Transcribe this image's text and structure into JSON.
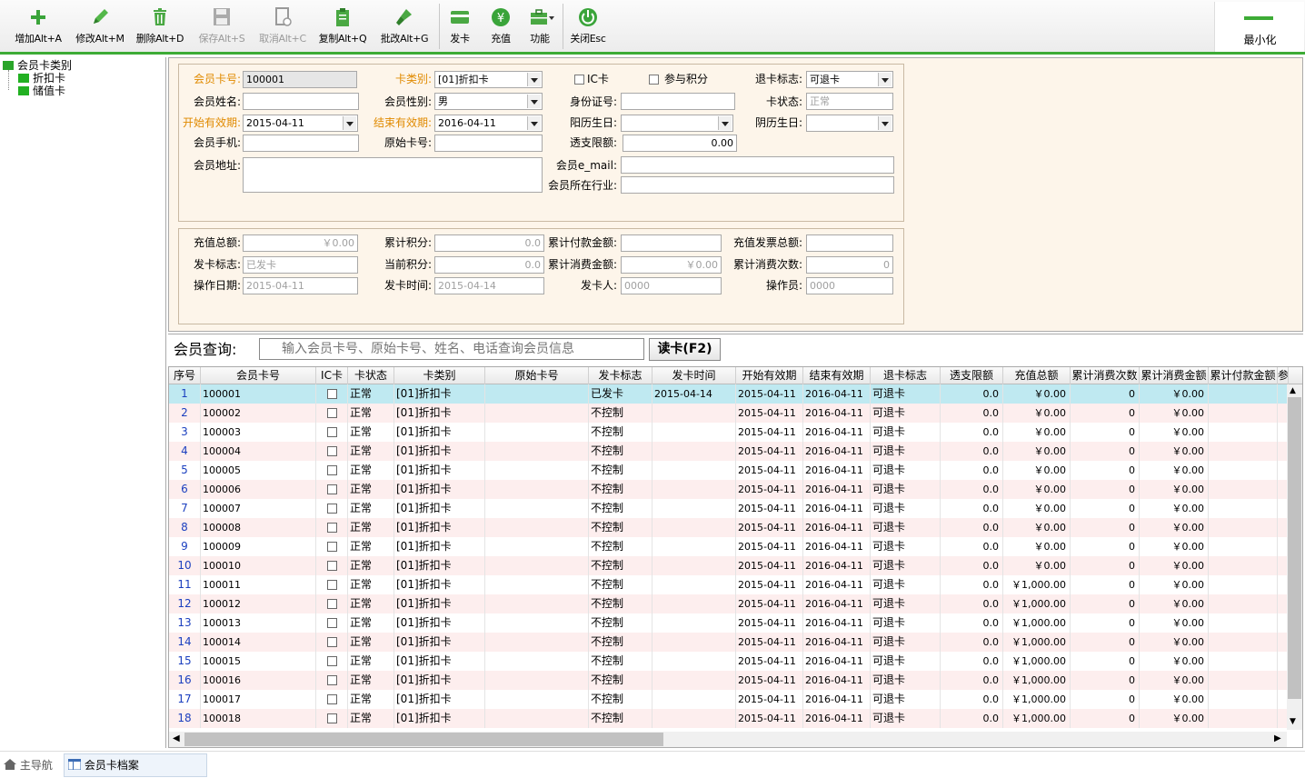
{
  "toolbar": {
    "add": "增加Alt+A",
    "edit": "修改Alt+M",
    "delete": "删除Alt+D",
    "save": "保存Alt+S",
    "cancel": "取消Alt+C",
    "copy": "复制Alt+Q",
    "batch": "批改Alt+G",
    "issue": "发卡",
    "recharge": "充值",
    "function": "功能",
    "close": "关闭Esc",
    "minimize": "最小化"
  },
  "tree": {
    "root": "会员卡类别",
    "items": [
      "折扣卡",
      "储值卡"
    ]
  },
  "form": {
    "card_no_label": "会员卡号:",
    "card_no": "100001",
    "card_type_label": "卡类别:",
    "card_type": "[01]折扣卡",
    "ic_label": "IC卡",
    "points_label": "参与积分",
    "refund_flag_label": "退卡标志:",
    "refund_flag": "可退卡",
    "name_label": "会员姓名:",
    "name": "",
    "gender_label": "会员性别:",
    "gender": "男",
    "id_label": "身份证号:",
    "id_no": "",
    "card_status_label": "卡状态:",
    "card_status": "正常",
    "start_label": "开始有效期:",
    "start": "2015-04-11",
    "end_label": "结束有效期:",
    "end": "2016-04-11",
    "solar_bday_label": "阳历生日:",
    "solar_bday": "",
    "lunar_bday_label": "阴历生日:",
    "lunar_bday": "",
    "phone_label": "会员手机:",
    "phone": "",
    "orig_card_label": "原始卡号:",
    "orig_card": "",
    "overdraft_label": "透支限额:",
    "overdraft": "0.00",
    "address_label": "会员地址:",
    "address": "",
    "email_label": "会员e_mail:",
    "email": "",
    "industry_label": "会员所在行业:",
    "industry": ""
  },
  "stats": {
    "recharge_total_label": "充值总额:",
    "recharge_total": "￥0.00",
    "cum_points_label": "累计积分:",
    "cum_points": "0.0",
    "cum_pay_label": "累计付款金额:",
    "cum_pay": "",
    "invoice_label": "充值发票总额:",
    "invoice": "",
    "issue_flag_label": "发卡标志:",
    "issue_flag": "已发卡",
    "cur_points_label": "当前积分:",
    "cur_points": "0.0",
    "cum_spend_label": "累计消费金额:",
    "cum_spend": "￥0.00",
    "spend_count_label": "累计消费次数:",
    "spend_count": "0",
    "op_date_label": "操作日期:",
    "op_date": "2015-04-11",
    "issue_time_label": "发卡时间:",
    "issue_time": "2015-04-14",
    "issuer_label": "发卡人:",
    "issuer": "0000",
    "operator_label": "操作员:",
    "operator": "0000"
  },
  "search": {
    "label": "会员查询:",
    "placeholder": "输入会员卡号、原始卡号、姓名、电话查询会员信息",
    "read_button": "读卡(F2)"
  },
  "grid": {
    "columns": [
      "序号",
      "会员卡号",
      "IC卡",
      "卡状态",
      "卡类别",
      "原始卡号",
      "发卡标志",
      "发卡时间",
      "开始有效期",
      "结束有效期",
      "退卡标志",
      "透支限额",
      "充值总额",
      "累计消费次数",
      "累计消费金额",
      "累计付款金额",
      "参"
    ],
    "rows": [
      [
        "1",
        "100001",
        "正常",
        "[01]折扣卡",
        "",
        "已发卡",
        "2015-04-14",
        "2015-04-11",
        "2016-04-11",
        "可退卡",
        "0.0",
        "￥0.00",
        "0",
        "￥0.00"
      ],
      [
        "2",
        "100002",
        "正常",
        "[01]折扣卡",
        "",
        "不控制",
        "",
        "2015-04-11",
        "2016-04-11",
        "可退卡",
        "0.0",
        "￥0.00",
        "0",
        "￥0.00"
      ],
      [
        "3",
        "100003",
        "正常",
        "[01]折扣卡",
        "",
        "不控制",
        "",
        "2015-04-11",
        "2016-04-11",
        "可退卡",
        "0.0",
        "￥0.00",
        "0",
        "￥0.00"
      ],
      [
        "4",
        "100004",
        "正常",
        "[01]折扣卡",
        "",
        "不控制",
        "",
        "2015-04-11",
        "2016-04-11",
        "可退卡",
        "0.0",
        "￥0.00",
        "0",
        "￥0.00"
      ],
      [
        "5",
        "100005",
        "正常",
        "[01]折扣卡",
        "",
        "不控制",
        "",
        "2015-04-11",
        "2016-04-11",
        "可退卡",
        "0.0",
        "￥0.00",
        "0",
        "￥0.00"
      ],
      [
        "6",
        "100006",
        "正常",
        "[01]折扣卡",
        "",
        "不控制",
        "",
        "2015-04-11",
        "2016-04-11",
        "可退卡",
        "0.0",
        "￥0.00",
        "0",
        "￥0.00"
      ],
      [
        "7",
        "100007",
        "正常",
        "[01]折扣卡",
        "",
        "不控制",
        "",
        "2015-04-11",
        "2016-04-11",
        "可退卡",
        "0.0",
        "￥0.00",
        "0",
        "￥0.00"
      ],
      [
        "8",
        "100008",
        "正常",
        "[01]折扣卡",
        "",
        "不控制",
        "",
        "2015-04-11",
        "2016-04-11",
        "可退卡",
        "0.0",
        "￥0.00",
        "0",
        "￥0.00"
      ],
      [
        "9",
        "100009",
        "正常",
        "[01]折扣卡",
        "",
        "不控制",
        "",
        "2015-04-11",
        "2016-04-11",
        "可退卡",
        "0.0",
        "￥0.00",
        "0",
        "￥0.00"
      ],
      [
        "10",
        "100010",
        "正常",
        "[01]折扣卡",
        "",
        "不控制",
        "",
        "2015-04-11",
        "2016-04-11",
        "可退卡",
        "0.0",
        "￥0.00",
        "0",
        "￥0.00"
      ],
      [
        "11",
        "100011",
        "正常",
        "[01]折扣卡",
        "",
        "不控制",
        "",
        "2015-04-11",
        "2016-04-11",
        "可退卡",
        "0.0",
        "￥1,000.00",
        "0",
        "￥0.00"
      ],
      [
        "12",
        "100012",
        "正常",
        "[01]折扣卡",
        "",
        "不控制",
        "",
        "2015-04-11",
        "2016-04-11",
        "可退卡",
        "0.0",
        "￥1,000.00",
        "0",
        "￥0.00"
      ],
      [
        "13",
        "100013",
        "正常",
        "[01]折扣卡",
        "",
        "不控制",
        "",
        "2015-04-11",
        "2016-04-11",
        "可退卡",
        "0.0",
        "￥1,000.00",
        "0",
        "￥0.00"
      ],
      [
        "14",
        "100014",
        "正常",
        "[01]折扣卡",
        "",
        "不控制",
        "",
        "2015-04-11",
        "2016-04-11",
        "可退卡",
        "0.0",
        "￥1,000.00",
        "0",
        "￥0.00"
      ],
      [
        "15",
        "100015",
        "正常",
        "[01]折扣卡",
        "",
        "不控制",
        "",
        "2015-04-11",
        "2016-04-11",
        "可退卡",
        "0.0",
        "￥1,000.00",
        "0",
        "￥0.00"
      ],
      [
        "16",
        "100016",
        "正常",
        "[01]折扣卡",
        "",
        "不控制",
        "",
        "2015-04-11",
        "2016-04-11",
        "可退卡",
        "0.0",
        "￥1,000.00",
        "0",
        "￥0.00"
      ],
      [
        "17",
        "100017",
        "正常",
        "[01]折扣卡",
        "",
        "不控制",
        "",
        "2015-04-11",
        "2016-04-11",
        "可退卡",
        "0.0",
        "￥1,000.00",
        "0",
        "￥0.00"
      ],
      [
        "18",
        "100018",
        "正常",
        "[01]折扣卡",
        "",
        "不控制",
        "",
        "2015-04-11",
        "2016-04-11",
        "可退卡",
        "0.0",
        "￥1,000.00",
        "0",
        "￥0.00"
      ]
    ]
  },
  "statusbar": {
    "nav": "主导航",
    "tab": "会员卡档案"
  },
  "colors": {
    "accent": "#3dab36",
    "selected_row": "#bfe9f1",
    "alt_row": "#fdeeee",
    "panel": "#fdf5ea",
    "required_label": "#e08a00"
  }
}
